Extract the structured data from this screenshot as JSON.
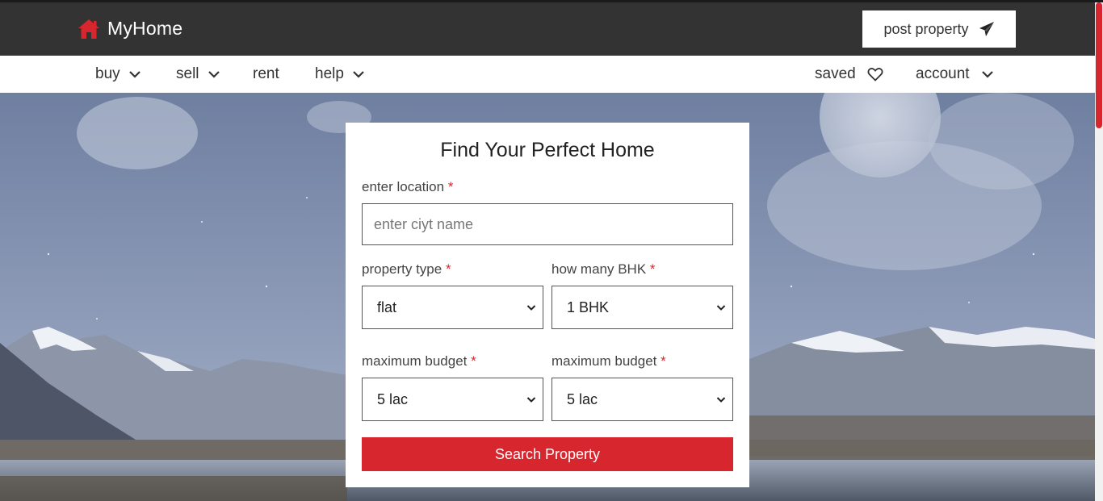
{
  "brand": {
    "name": "MyHome",
    "icon": "home-icon"
  },
  "header": {
    "post_label": "post property",
    "post_icon": "paper-plane-icon"
  },
  "nav": {
    "left": [
      {
        "label": "buy",
        "icon": "chevron-down-icon"
      },
      {
        "label": "sell",
        "icon": "chevron-down-icon"
      },
      {
        "label": "rent"
      },
      {
        "label": "help",
        "icon": "chevron-down-icon"
      }
    ],
    "saved_label": "saved",
    "saved_icon": "heart-icon",
    "account_label": "account",
    "account_icon": "chevron-down-icon"
  },
  "form": {
    "title": "Find Your Perfect Home",
    "location_label": "enter location",
    "location_placeholder": "enter ciyt name",
    "location_value": "",
    "property_type_label": "property type",
    "property_type_value": "flat",
    "bhk_label": "how many BHK",
    "bhk_value": "1 BHK",
    "budget1_label": "maximum budget",
    "budget1_value": "5 lac",
    "budget2_label": "maximum budget",
    "budget2_value": "5 lac",
    "required_mark": "*",
    "search_label": "Search Property"
  },
  "colors": {
    "header_bg": "#333333",
    "accent": "#d8262e",
    "navbar_bg": "#ffffff"
  }
}
